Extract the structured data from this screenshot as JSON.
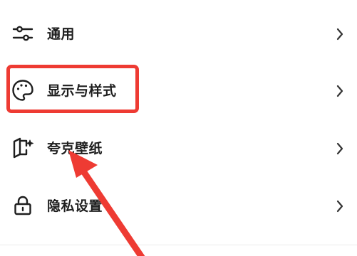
{
  "settings": {
    "items": [
      {
        "label": "通用",
        "icon": "sliders-icon"
      },
      {
        "label": "显示与样式",
        "icon": "palette-icon"
      },
      {
        "label": "夸克壁纸",
        "icon": "wallpaper-sparkle-icon"
      },
      {
        "label": "隐私设置",
        "icon": "lock-icon"
      }
    ]
  },
  "annotation": {
    "highlight_color": "#ee3b33",
    "arrow_color": "#ee3b33"
  }
}
